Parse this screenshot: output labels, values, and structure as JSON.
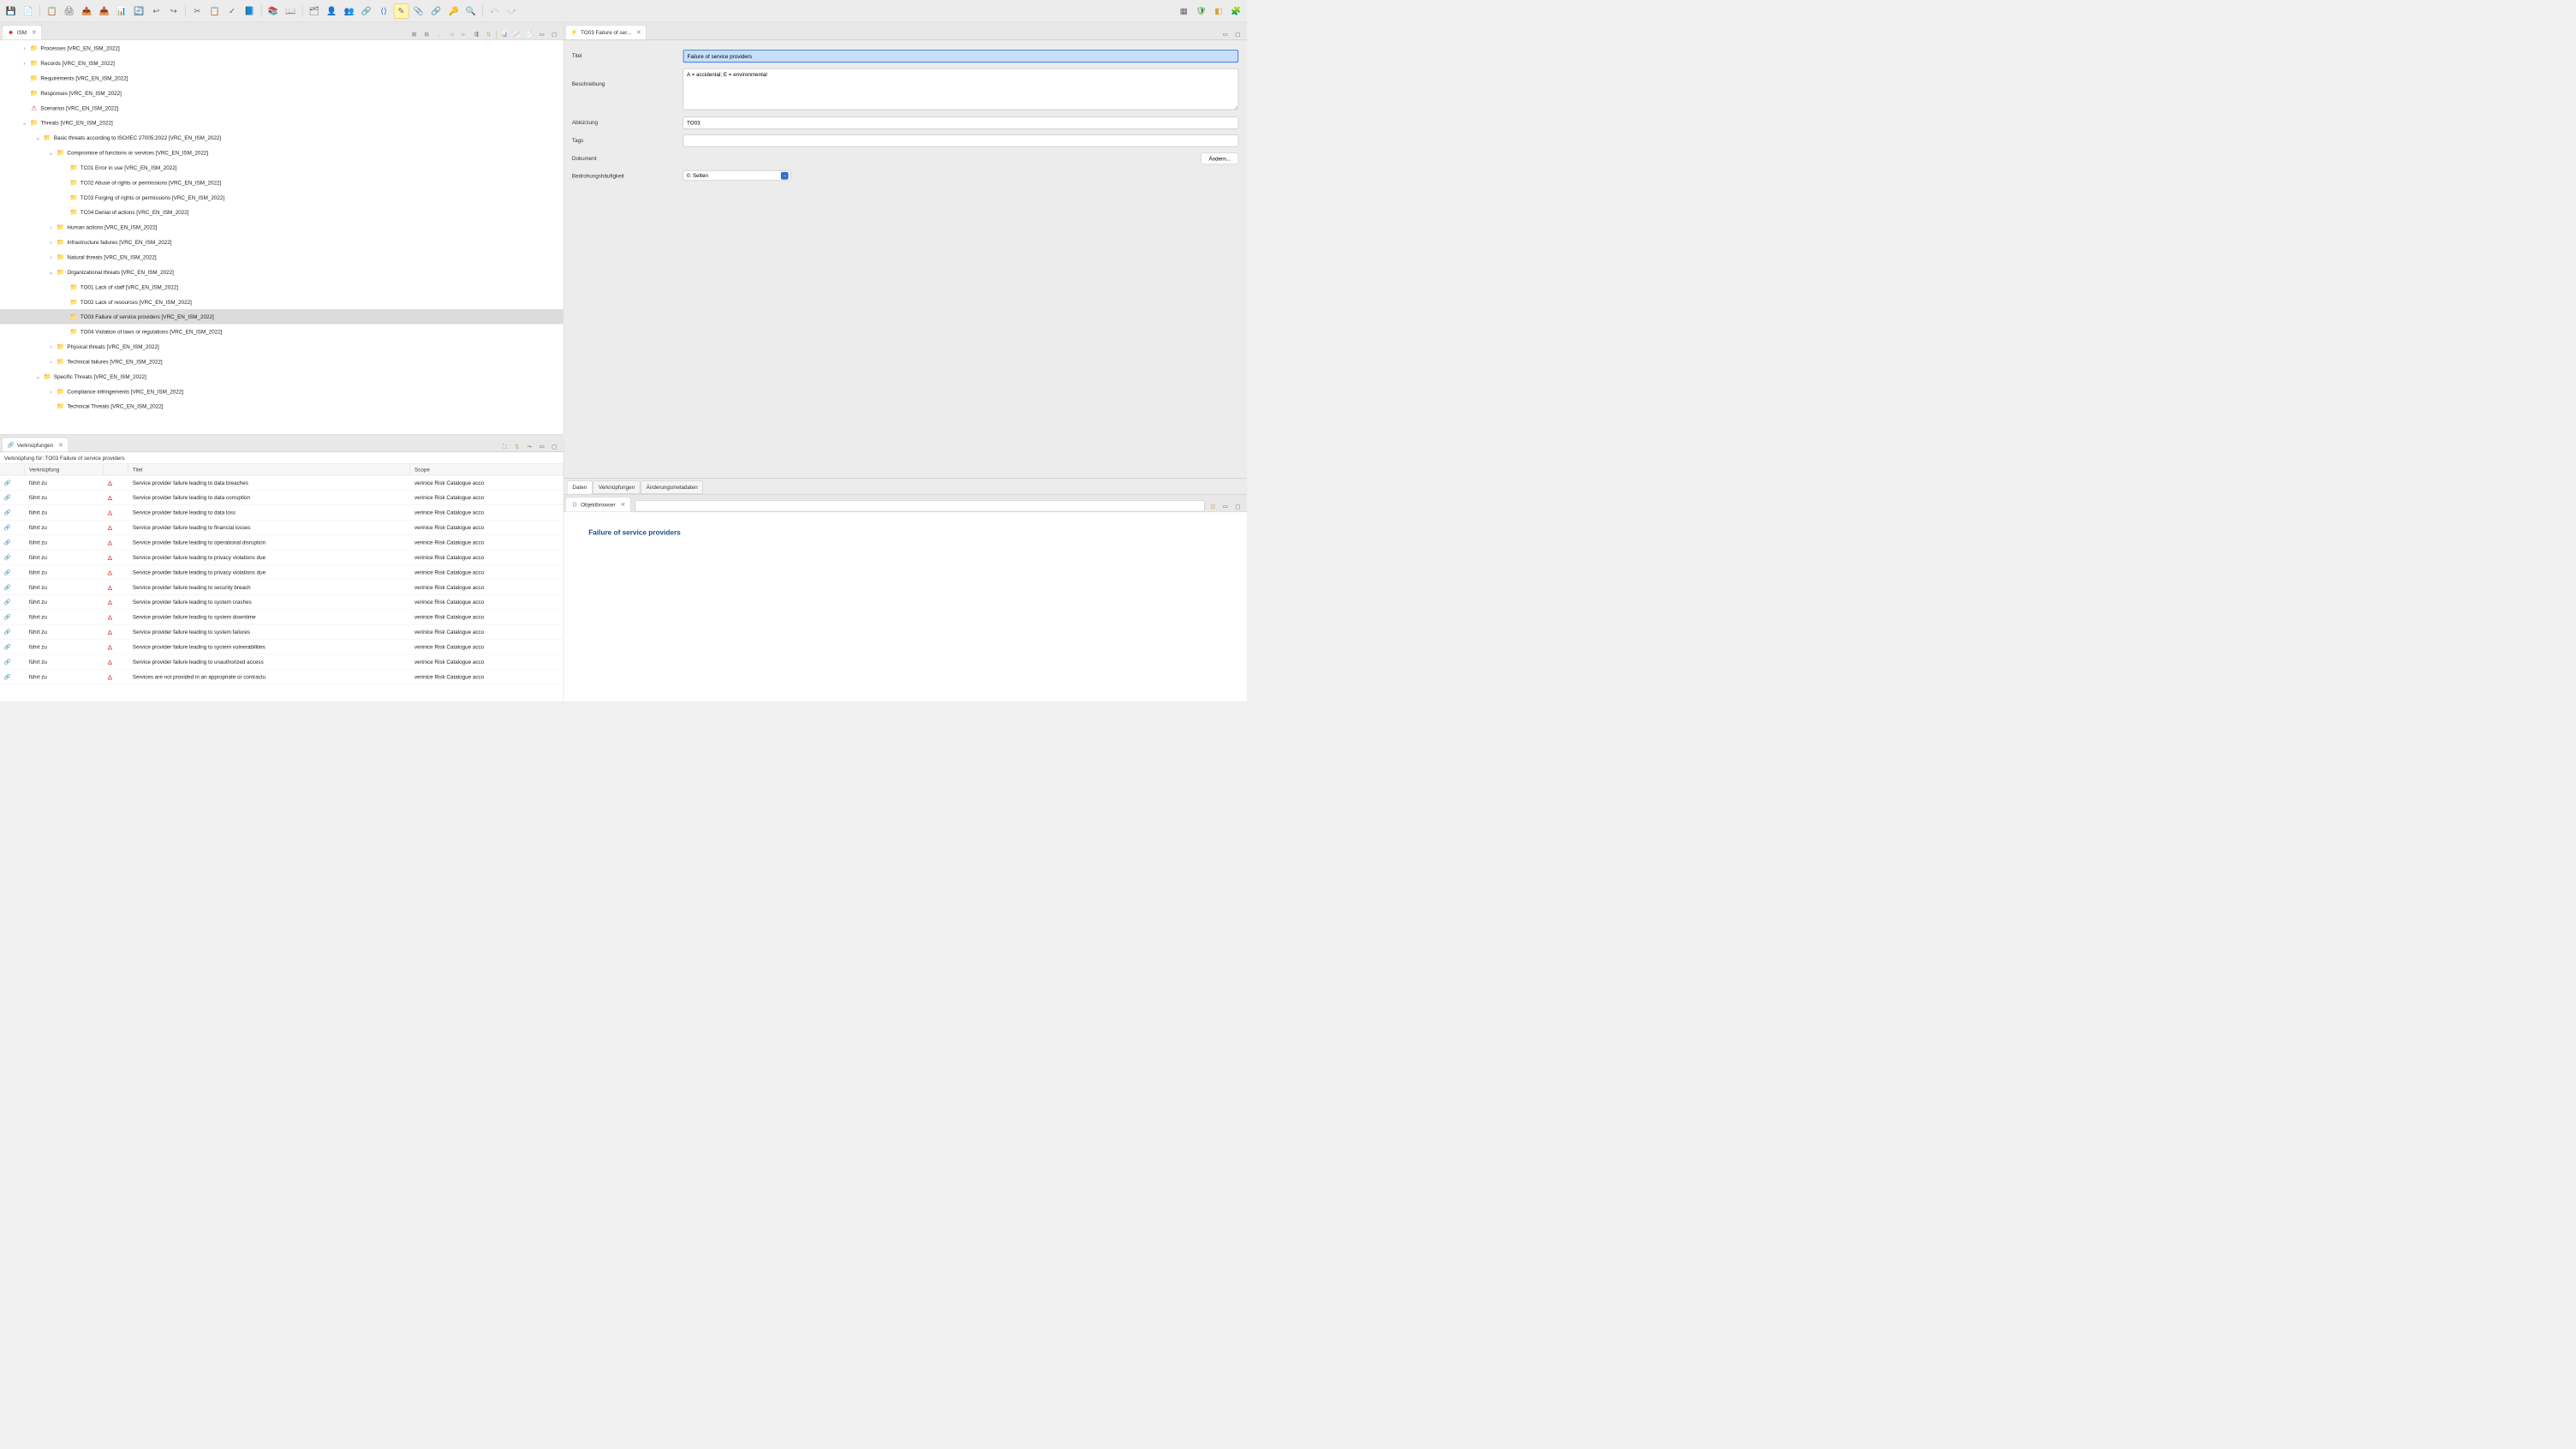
{
  "ism_tab": "ISM",
  "tree": [
    {
      "depth": 1,
      "arrow": ">",
      "icon": "folder",
      "label": "Processes [VRC_EN_ISM_2022]"
    },
    {
      "depth": 1,
      "arrow": ">",
      "icon": "folder",
      "label": "Records [VRC_EN_ISM_2022]"
    },
    {
      "depth": 1,
      "arrow": "",
      "icon": "folder",
      "label": "Requirements [VRC_EN_ISM_2022]"
    },
    {
      "depth": 1,
      "arrow": "",
      "icon": "folder",
      "label": "Responses [VRC_EN_ISM_2022]"
    },
    {
      "depth": 1,
      "arrow": "",
      "icon": "scenario",
      "label": "Scenarios [VRC_EN_ISM_2022]"
    },
    {
      "depth": 1,
      "arrow": "v",
      "icon": "folder",
      "label": "Threats [VRC_EN_ISM_2022]"
    },
    {
      "depth": 2,
      "arrow": "v",
      "icon": "folder",
      "label": "Basic threats according to ISO/IEC 27005:2022 [VRC_EN_ISM_2022]"
    },
    {
      "depth": 3,
      "arrow": "v",
      "icon": "folder",
      "label": "Compromise of functions or services [VRC_EN_ISM_2022]"
    },
    {
      "depth": 4,
      "arrow": "",
      "icon": "threat",
      "label": "TC01 Error in use [VRC_EN_ISM_2022]"
    },
    {
      "depth": 4,
      "arrow": "",
      "icon": "threat",
      "label": "TC02 Abuse of rights or permissions [VRC_EN_ISM_2022]"
    },
    {
      "depth": 4,
      "arrow": "",
      "icon": "threat",
      "label": "TC03 Forging of rights or permissions [VRC_EN_ISM_2022]"
    },
    {
      "depth": 4,
      "arrow": "",
      "icon": "threat",
      "label": "TC04 Denial of actions [VRC_EN_ISM_2022]"
    },
    {
      "depth": 3,
      "arrow": ">",
      "icon": "folder",
      "label": "Human actions [VRC_EN_ISM_2022]"
    },
    {
      "depth": 3,
      "arrow": ">",
      "icon": "folder",
      "label": "Infrastructure failures [VRC_EN_ISM_2022]"
    },
    {
      "depth": 3,
      "arrow": ">",
      "icon": "folder",
      "label": "Natural threats [VRC_EN_ISM_2022]"
    },
    {
      "depth": 3,
      "arrow": "v",
      "icon": "folder",
      "label": "Organizational threats [VRC_EN_ISM_2022]"
    },
    {
      "depth": 4,
      "arrow": "",
      "icon": "threat",
      "label": "TO01 Lack of staff [VRC_EN_ISM_2022]"
    },
    {
      "depth": 4,
      "arrow": "",
      "icon": "threat",
      "label": "TO02 Lack of resources [VRC_EN_ISM_2022]"
    },
    {
      "depth": 4,
      "arrow": "",
      "icon": "threat",
      "label": "TO03 Failure of service providers [VRC_EN_ISM_2022]",
      "selected": true
    },
    {
      "depth": 4,
      "arrow": "",
      "icon": "threat",
      "label": "TO04 Violation of laws or regulations [VRC_EN_ISM_2022]"
    },
    {
      "depth": 3,
      "arrow": ">",
      "icon": "folder",
      "label": "Physical threats [VRC_EN_ISM_2022]"
    },
    {
      "depth": 3,
      "arrow": ">",
      "icon": "folder",
      "label": "Technical failures [VRC_EN_ISM_2022]"
    },
    {
      "depth": 2,
      "arrow": "v",
      "icon": "folder",
      "label": "Specific Threats [VRC_EN_ISM_2022]"
    },
    {
      "depth": 3,
      "arrow": ">",
      "icon": "folder",
      "label": "Compliance infringements [VRC_EN_ISM_2022]"
    },
    {
      "depth": 3,
      "arrow": "",
      "icon": "folder",
      "label": "Technical Threats [VRC_EN_ISM_2022]"
    }
  ],
  "links": {
    "tab": "Verknüpfungen",
    "caption": "Verknüpfung für: TO03 Failure of service providers",
    "headers": {
      "link": "Verknüpfung",
      "title": "Titel",
      "scope": "Scope"
    },
    "rows": [
      {
        "link": "führt zu",
        "title": "Service provider failure leading to data breaches",
        "scope": "verinice Risk Catalogue acco"
      },
      {
        "link": "führt zu",
        "title": "Service provider failure leading to data corruption",
        "scope": "verinice Risk Catalogue acco"
      },
      {
        "link": "führt zu",
        "title": "Service provider failure leading to data loss",
        "scope": "verinice Risk Catalogue acco"
      },
      {
        "link": "führt zu",
        "title": "Service provider failure leading to financial losses",
        "scope": "verinice Risk Catalogue acco"
      },
      {
        "link": "führt zu",
        "title": "Service provider failure leading to operational disruption",
        "scope": "verinice Risk Catalogue acco"
      },
      {
        "link": "führt zu",
        "title": "Service provider failure leading to privacy violations due",
        "scope": "verinice Risk Catalogue acco"
      },
      {
        "link": "führt zu",
        "title": "Service provider failure leading to privacy violations due",
        "scope": "verinice Risk Catalogue acco"
      },
      {
        "link": "führt zu",
        "title": "Service provider failure leading to security breach",
        "scope": "verinice Risk Catalogue acco"
      },
      {
        "link": "führt zu",
        "title": "Service provider failure leading to system crashes",
        "scope": "verinice Risk Catalogue acco"
      },
      {
        "link": "führt zu",
        "title": "Service provider failure leading to system downtime",
        "scope": "verinice Risk Catalogue acco"
      },
      {
        "link": "führt zu",
        "title": "Service provider failure leading to system failures",
        "scope": "verinice Risk Catalogue acco"
      },
      {
        "link": "führt zu",
        "title": "Service provider failure leading to system vulnerabilities",
        "scope": "verinice Risk Catalogue acco"
      },
      {
        "link": "führt zu",
        "title": "Service provider failure leading to unauthorized access",
        "scope": "verinice Risk Catalogue acco"
      },
      {
        "link": "führt zu",
        "title": "Services are not provided in an appropriate or contractu",
        "scope": "verinice Risk Catalogue acco"
      }
    ]
  },
  "editor": {
    "tab": "TO03 Failure of ser...",
    "labels": {
      "title": "Titel",
      "desc": "Beschreibung",
      "abbr": "Abkürzung",
      "tags": "Tags",
      "doc": "Dokument",
      "freq": "Bedrohungshäufigkeit"
    },
    "values": {
      "title": "Failure of service providers",
      "desc": "A = accidental; E = environmental",
      "abbr": "TO03",
      "tags": "",
      "freq": "0: Selten"
    },
    "buttons": {
      "change": "Ändern..."
    },
    "tabs": {
      "data": "Daten",
      "links": "Verknüpfungen",
      "meta": "Änderungsmetadaten"
    }
  },
  "browser": {
    "tab": "Objektbrowser",
    "title": "Failure of service providers"
  }
}
